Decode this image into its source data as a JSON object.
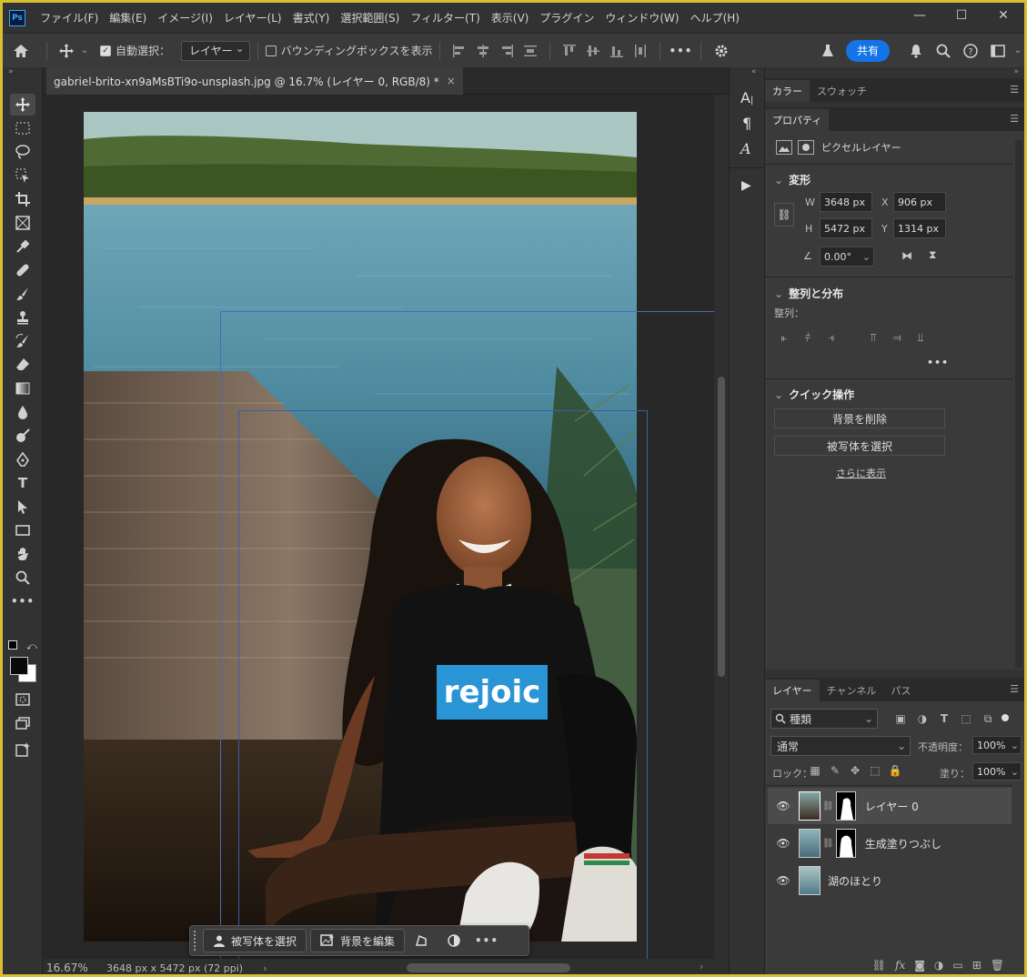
{
  "menubar": {
    "logo": "Ps",
    "items": [
      "ファイル(F)",
      "編集(E)",
      "イメージ(I)",
      "レイヤー(L)",
      "書式(Y)",
      "選択範囲(S)",
      "フィルター(T)",
      "表示(V)",
      "プラグイン",
      "ウィンドウ(W)",
      "ヘルプ(H)"
    ]
  },
  "optbar": {
    "auto_select_label": "自動選択：",
    "auto_select_target": "レイヤー",
    "bounding_box_label": "バウンディングボックスを表示",
    "more": "•••",
    "share": "共有"
  },
  "document": {
    "tab_title": "gabriel-brito-xn9aMsBTi9o-unsplash.jpg @ 16.7% (レイヤー 0, RGB/8) *",
    "close": "×",
    "shirt_text": "rejoic"
  },
  "status": {
    "zoom": "16.67%",
    "dimensions": "3648 px x 5472 px (72 ppi)",
    "arrow": "›"
  },
  "taskbar": {
    "select_subject": "被写体を選択",
    "edit_background": "背景を編集",
    "more": "•••"
  },
  "panels": {
    "color_tab": "カラー",
    "swatches_tab": "スウォッチ",
    "properties_tab": "プロパティ",
    "layer_type": "ピクセルレイヤー",
    "transform": {
      "title": "変形",
      "w_label": "W",
      "w_value": "3648 px",
      "h_label": "H",
      "h_value": "5472 px",
      "x_label": "X",
      "x_value": "906 px",
      "y_label": "Y",
      "y_value": "1314 px",
      "angle": "0.00°"
    },
    "align": {
      "title": "整列と分布",
      "subtitle": "整列：",
      "more": "•••"
    },
    "quick": {
      "title": "クイック操作",
      "remove_bg": "背景を削除",
      "select_subject": "被写体を選択",
      "show_more": "さらに表示"
    }
  },
  "layers": {
    "tabs": [
      "レイヤー",
      "チャンネル",
      "パス"
    ],
    "kind_filter": "種類",
    "blend_mode": "通常",
    "opacity_label": "不透明度：",
    "opacity_value": "100%",
    "lock_label": "ロック：",
    "fill_label": "塗り：",
    "fill_value": "100%",
    "items": [
      {
        "name": "レイヤー 0"
      },
      {
        "name": "生成塗りつぶし"
      },
      {
        "name": "湖のほとり"
      }
    ]
  },
  "colors": {
    "accent": "#1473e6",
    "frame": "#d8bf2e",
    "panel": "#323232"
  }
}
